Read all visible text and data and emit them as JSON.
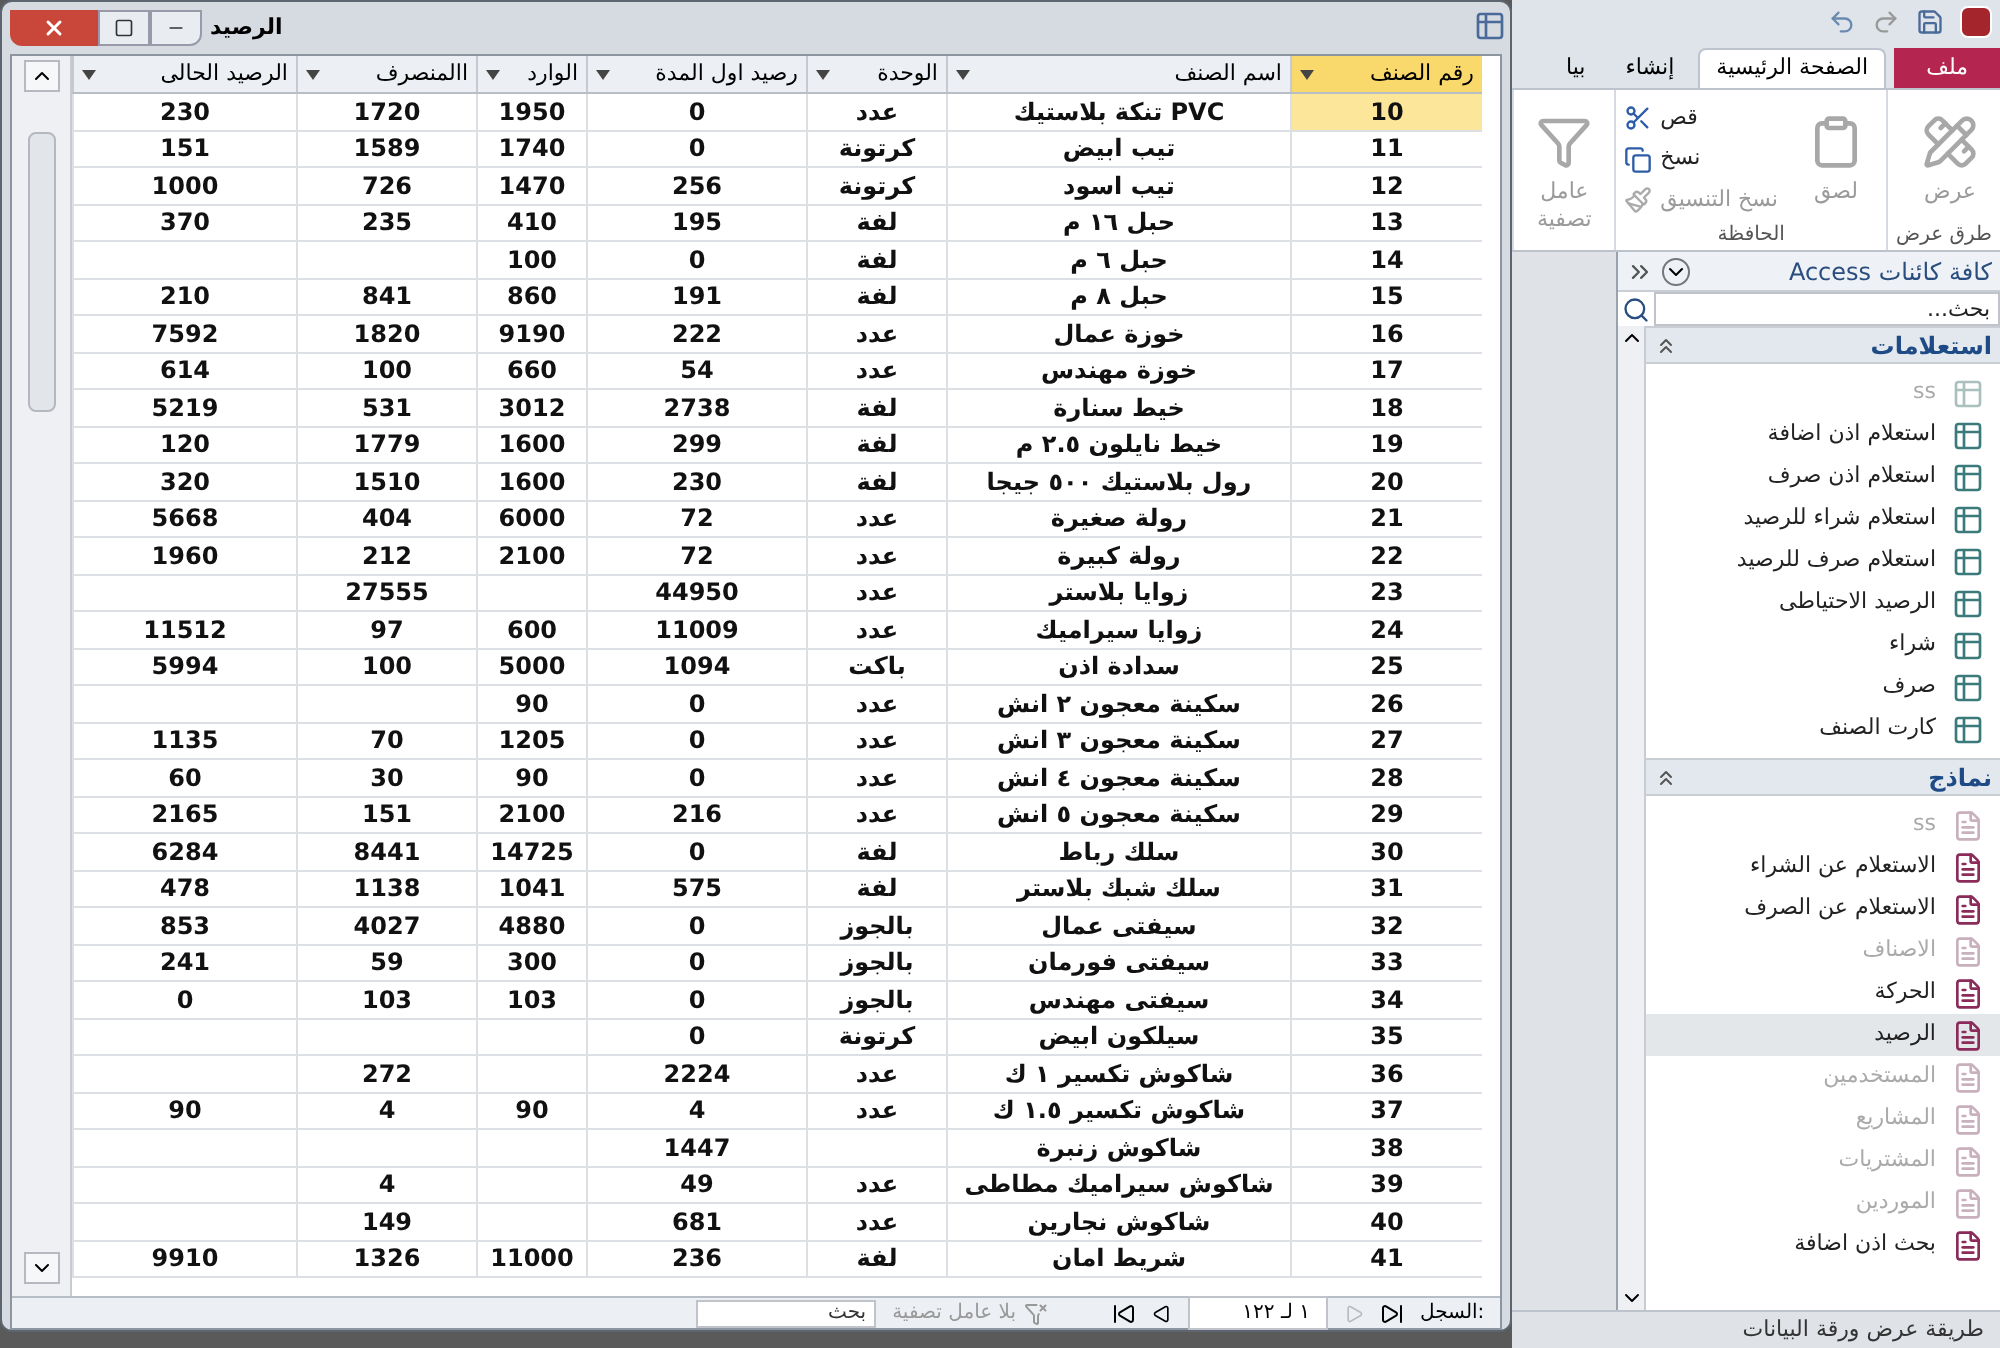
{
  "datasheet_window": {
    "title": "الرصيد",
    "columns": [
      {
        "label": "رقم الصنف",
        "selected": true
      },
      {
        "label": "اسم الصنف",
        "selected": false
      },
      {
        "label": "الوحدة",
        "selected": false
      },
      {
        "label": "رصيد اول المدة",
        "selected": false
      },
      {
        "label": "الوارد",
        "selected": false
      },
      {
        "label": "االمنصرف",
        "selected": false
      },
      {
        "label": "الرصيد الحالى",
        "selected": false
      }
    ],
    "rows": [
      {
        "selected": true,
        "cells": [
          "10",
          "تنكة بلاستيك PVC",
          "عدد",
          "0",
          "1950",
          "1720",
          "230"
        ]
      },
      {
        "selected": false,
        "cells": [
          "11",
          "تيب ابيض",
          "كرتونة",
          "0",
          "1740",
          "1589",
          "151"
        ]
      },
      {
        "selected": false,
        "cells": [
          "12",
          "تيب اسود",
          "كرتونة",
          "256",
          "1470",
          "726",
          "1000"
        ]
      },
      {
        "selected": false,
        "cells": [
          "13",
          "حبل ١٦ م",
          "لفة",
          "195",
          "410",
          "235",
          "370"
        ]
      },
      {
        "selected": false,
        "cells": [
          "14",
          "حبل ٦ م",
          "لفة",
          "0",
          "100",
          "",
          ""
        ]
      },
      {
        "selected": false,
        "cells": [
          "15",
          "حبل ٨ م",
          "لفة",
          "191",
          "860",
          "841",
          "210"
        ]
      },
      {
        "selected": false,
        "cells": [
          "16",
          "خوزة عمال",
          "عدد",
          "222",
          "9190",
          "1820",
          "7592"
        ]
      },
      {
        "selected": false,
        "cells": [
          "17",
          "خوزة مهندس",
          "عدد",
          "54",
          "660",
          "100",
          "614"
        ]
      },
      {
        "selected": false,
        "cells": [
          "18",
          "خيط سنارة",
          "لفة",
          "2738",
          "3012",
          "531",
          "5219"
        ]
      },
      {
        "selected": false,
        "cells": [
          "19",
          "خيط نايلون ٢.٥ م",
          "لفة",
          "299",
          "1600",
          "1779",
          "120"
        ]
      },
      {
        "selected": false,
        "cells": [
          "20",
          "رول بلاستيك ٥٠٠ جيجا",
          "لفة",
          "230",
          "1600",
          "1510",
          "320"
        ]
      },
      {
        "selected": false,
        "cells": [
          "21",
          "رولة صغيرة",
          "عدد",
          "72",
          "6000",
          "404",
          "5668"
        ]
      },
      {
        "selected": false,
        "cells": [
          "22",
          "رولة كبيرة",
          "عدد",
          "72",
          "2100",
          "212",
          "1960"
        ]
      },
      {
        "selected": false,
        "cells": [
          "23",
          "زوايا بلاستر",
          "عدد",
          "44950",
          "",
          "27555",
          ""
        ]
      },
      {
        "selected": false,
        "cells": [
          "24",
          "زوايا سيراميك",
          "عدد",
          "11009",
          "600",
          "97",
          "11512"
        ]
      },
      {
        "selected": false,
        "cells": [
          "25",
          "سدادة اذن",
          "باكت",
          "1094",
          "5000",
          "100",
          "5994"
        ]
      },
      {
        "selected": false,
        "cells": [
          "26",
          "سكينة معجون ٢ انش",
          "عدد",
          "0",
          "90",
          "",
          ""
        ]
      },
      {
        "selected": false,
        "cells": [
          "27",
          "سكينة معجون ٣ انش",
          "عدد",
          "0",
          "1205",
          "70",
          "1135"
        ]
      },
      {
        "selected": false,
        "cells": [
          "28",
          "سكينة معجون ٤ انش",
          "عدد",
          "0",
          "90",
          "30",
          "60"
        ]
      },
      {
        "selected": false,
        "cells": [
          "29",
          "سكينة معجون ٥ انش",
          "عدد",
          "216",
          "2100",
          "151",
          "2165"
        ]
      },
      {
        "selected": false,
        "cells": [
          "30",
          "سلك رباط",
          "لفة",
          "0",
          "14725",
          "8441",
          "6284"
        ]
      },
      {
        "selected": false,
        "cells": [
          "31",
          "سلك شبك بلاستر",
          "لفة",
          "575",
          "1041",
          "1138",
          "478"
        ]
      },
      {
        "selected": false,
        "cells": [
          "32",
          "سيفتى عمال",
          "بالجوز",
          "0",
          "4880",
          "4027",
          "853"
        ]
      },
      {
        "selected": false,
        "cells": [
          "33",
          "سيفتى فورمان",
          "بالجوز",
          "0",
          "300",
          "59",
          "241"
        ]
      },
      {
        "selected": false,
        "cells": [
          "34",
          "سيفتى مهندس",
          "بالجوز",
          "0",
          "103",
          "103",
          "0"
        ]
      },
      {
        "selected": false,
        "cells": [
          "35",
          "سيلكون ابيض",
          "كرتونة",
          "0",
          "",
          "",
          ""
        ]
      },
      {
        "selected": false,
        "cells": [
          "36",
          "شاكوش تكسير ١ ك",
          "عدد",
          "2224",
          "",
          "272",
          ""
        ]
      },
      {
        "selected": false,
        "cells": [
          "37",
          "شاكوش تكسير ١.٥ ك",
          "عدد",
          "4",
          "90",
          "4",
          "90"
        ]
      },
      {
        "selected": false,
        "cells": [
          "38",
          "شاكوش زنبرة",
          "",
          "1447",
          "",
          "",
          ""
        ]
      },
      {
        "selected": false,
        "cells": [
          "39",
          "شاكوش سيراميك مطاطى",
          "عدد",
          "49",
          "",
          "4",
          ""
        ]
      },
      {
        "selected": false,
        "cells": [
          "40",
          "شاكوش نجارين",
          "عدد",
          "681",
          "",
          "149",
          ""
        ]
      },
      {
        "selected": false,
        "cells": [
          "41",
          "شريط امان",
          "لفة",
          "236",
          "11000",
          "1326",
          "9910"
        ]
      }
    ],
    "record_navigator": {
      "label": "السجل:",
      "position": "١ لـ ١٢٢",
      "filter": "بلا عامل تصفية",
      "search_placeholder": "بحث"
    }
  },
  "ribbon": {
    "file_tab": "ملف",
    "tabs": [
      {
        "label": "الصفحة الرئيسية",
        "selected": true
      },
      {
        "label": "إنشاء",
        "selected": false
      },
      {
        "label": "بيا",
        "selected": false
      }
    ],
    "groups": [
      {
        "label": "طرق عرض",
        "buttons": [
          {
            "label": "عرض",
            "kind": "view",
            "disabled": true
          }
        ]
      },
      {
        "label": "الحافظة",
        "buttons": [
          {
            "label": "لصق",
            "kind": "paste",
            "disabled": true
          },
          {
            "label": "قص",
            "kind": "cut",
            "disabled": false
          },
          {
            "label": "نسخ",
            "kind": "copy",
            "disabled": false
          },
          {
            "label": "نسخ التنسيق",
            "kind": "format",
            "disabled": true
          }
        ]
      },
      {
        "buttons": [
          {
            "label": "عامل تصفية",
            "kind": "filter",
            "disabled": true
          }
        ]
      }
    ]
  },
  "navigation_pane": {
    "title": "كافة كائنات Access",
    "search_placeholder": "بحث...",
    "sections": [
      {
        "label": "استعلامات",
        "kind": "query",
        "items": [
          {
            "label": "ss",
            "disabled": true,
            "selected": false
          },
          {
            "label": "استعلام اذن اضافة",
            "disabled": false,
            "selected": false
          },
          {
            "label": "استعلام اذن صرف",
            "disabled": false,
            "selected": false
          },
          {
            "label": "استعلام شراء للرصيد",
            "disabled": false,
            "selected": false
          },
          {
            "label": "استعلام صرف للرصيد",
            "disabled": false,
            "selected": false
          },
          {
            "label": "الرصيد الاحتياطى",
            "disabled": false,
            "selected": false
          },
          {
            "label": "شراء",
            "disabled": false,
            "selected": false
          },
          {
            "label": "صرف",
            "disabled": false,
            "selected": false
          },
          {
            "label": "كارت الصنف",
            "disabled": false,
            "selected": false
          }
        ]
      },
      {
        "label": "نماذج",
        "kind": "form",
        "items": [
          {
            "label": "ss",
            "disabled": true,
            "selected": false
          },
          {
            "label": "الاستعلام عن الشراء",
            "disabled": false,
            "selected": false
          },
          {
            "label": "الاستعلام عن الصرف",
            "disabled": false,
            "selected": false
          },
          {
            "label": "الاصناف",
            "disabled": true,
            "selected": false
          },
          {
            "label": "الحركة",
            "disabled": false,
            "selected": false
          },
          {
            "label": "الرصيد",
            "disabled": false,
            "selected": true
          },
          {
            "label": "المستخدمين",
            "disabled": true,
            "selected": false
          },
          {
            "label": "المشاريع",
            "disabled": true,
            "selected": false
          },
          {
            "label": "المشتريات",
            "disabled": true,
            "selected": false
          },
          {
            "label": "الموردين",
            "disabled": true,
            "selected": false
          },
          {
            "label": "بحث اذن اضافة",
            "disabled": false,
            "selected": false
          }
        ]
      }
    ]
  },
  "status_bar": "طريقة عرض ورقة البيانات"
}
